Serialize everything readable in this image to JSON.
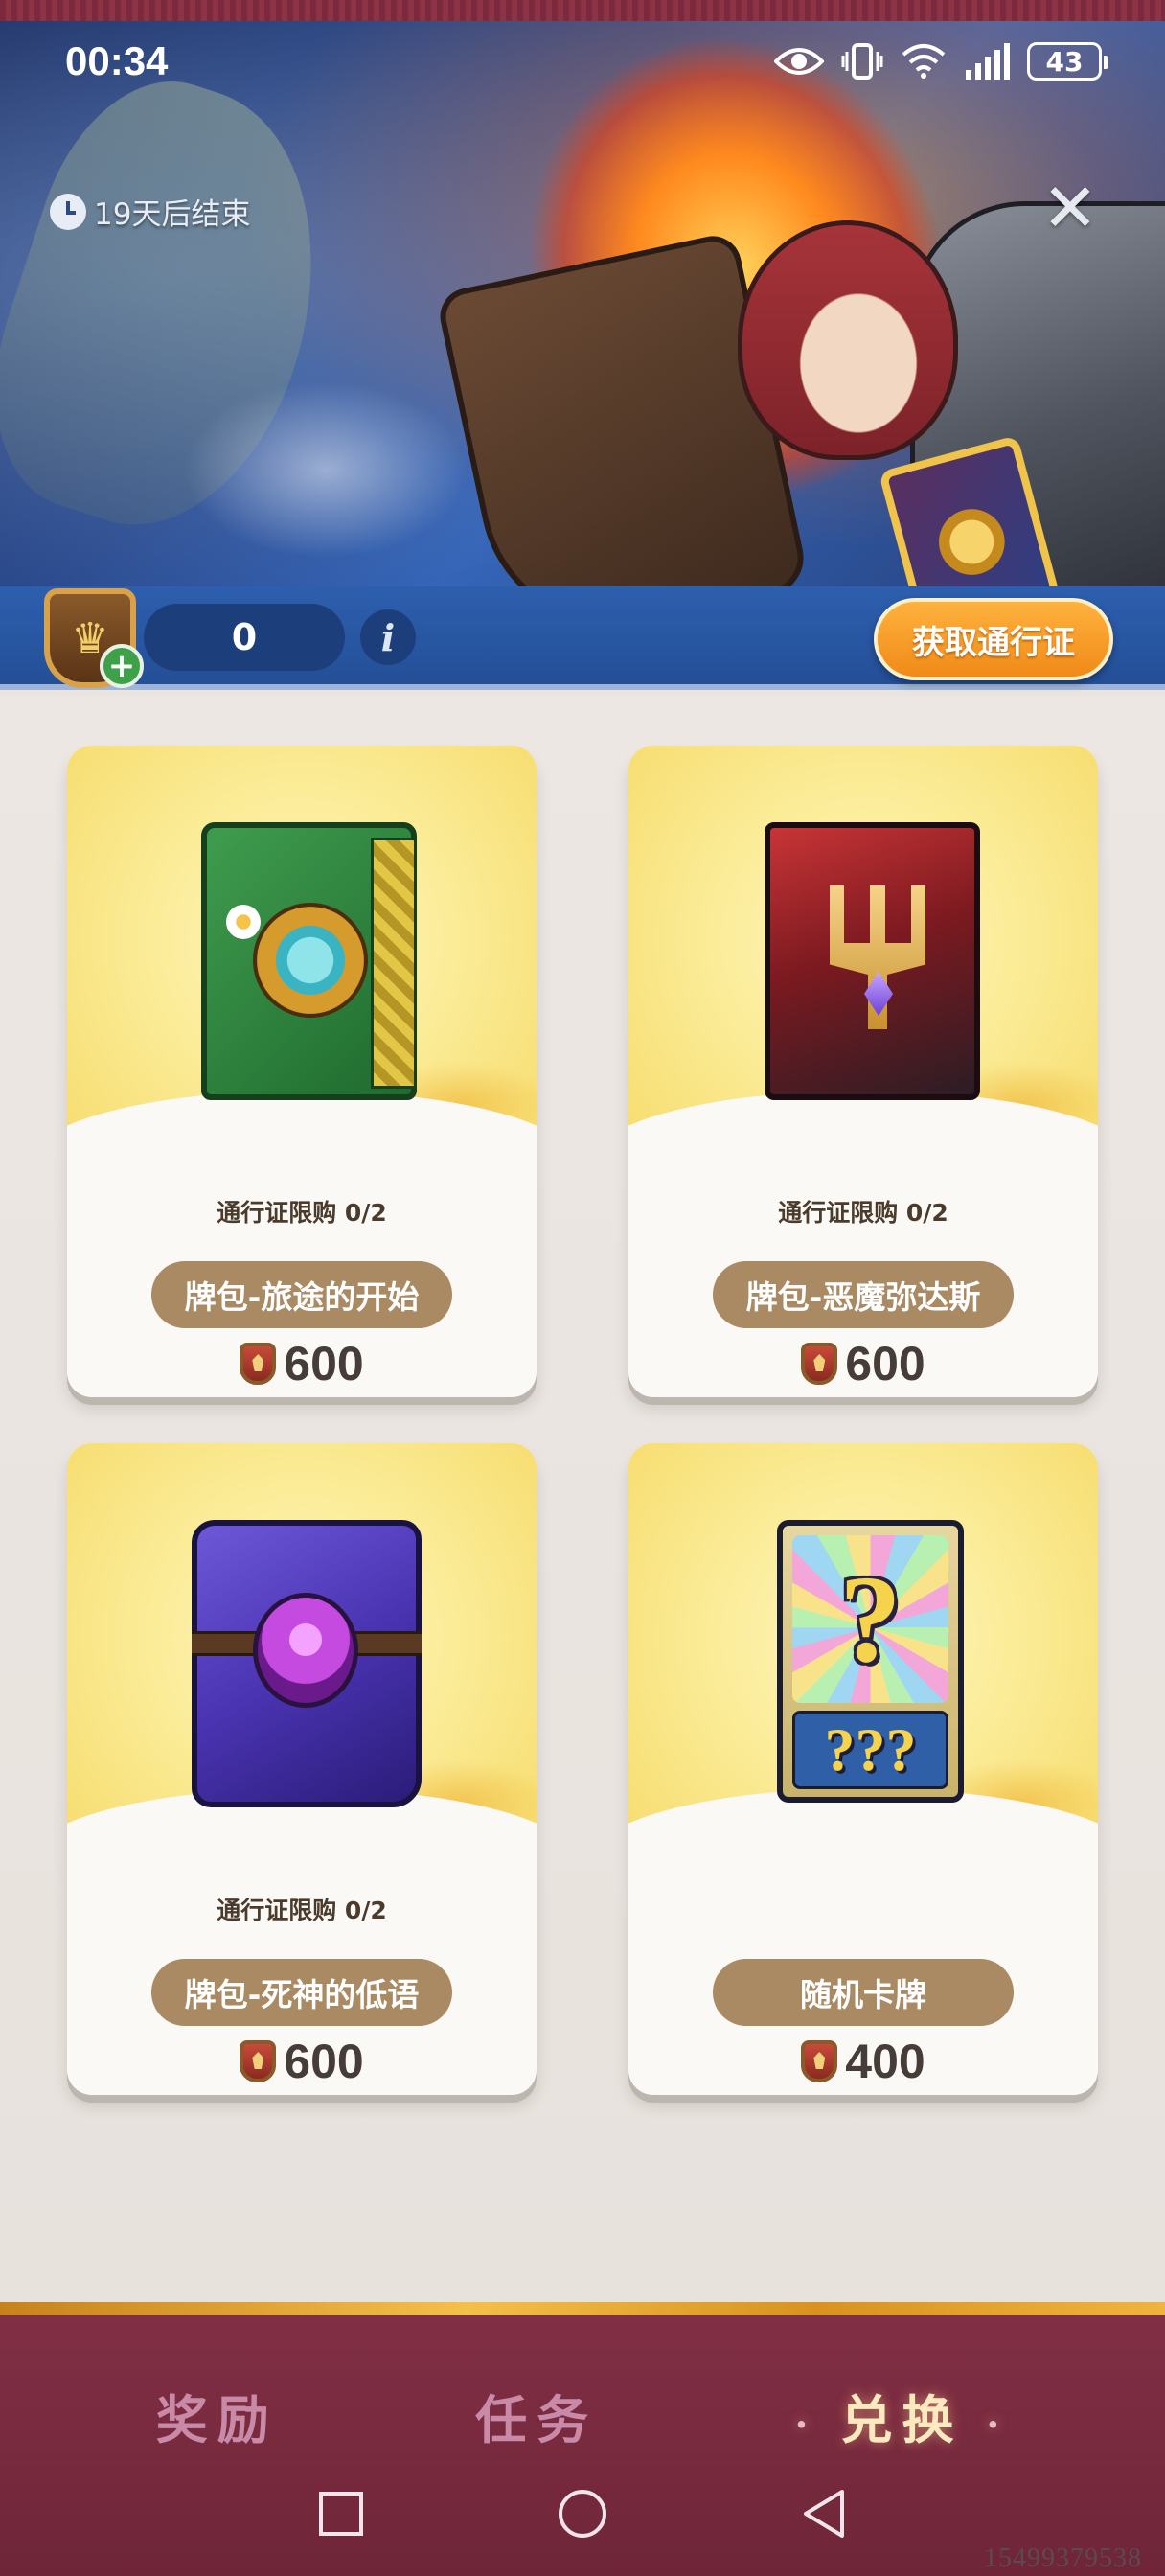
{
  "status_bar": {
    "time": "00:34",
    "battery": "43",
    "icons": [
      "eye-icon",
      "vibrate-icon",
      "wifi-icon",
      "signal-icon",
      "battery-icon"
    ]
  },
  "banner": {
    "timer_text": "19天后结束",
    "close_label": "✕",
    "points": "0",
    "info_label": "i",
    "get_pass_label": "获取通行证"
  },
  "cards": [
    {
      "limit": "通行证限购 0/2",
      "name": "牌包-旅途的开始",
      "price": "600",
      "art": "green-card-pack-icon"
    },
    {
      "limit": "通行证限购 0/2",
      "name": "牌包-恶魔弥达斯",
      "price": "600",
      "art": "red-card-pack-icon"
    },
    {
      "limit": "通行证限购 0/2",
      "name": "牌包-死神的低语",
      "price": "600",
      "art": "purple-card-pack-icon"
    },
    {
      "limit": "",
      "name": "随机卡牌",
      "price": "400",
      "art": "random-card-icon"
    }
  ],
  "random_card": {
    "big_mark": "?",
    "small_mark": "???"
  },
  "tabs": [
    {
      "label": "奖励",
      "active": false
    },
    {
      "label": "任务",
      "active": false
    },
    {
      "label": "兑换",
      "active": true
    }
  ],
  "watermark": "15499379538",
  "colors": {
    "banner_blue": "#2d5fae",
    "accent_orange": "#f08a18",
    "nav_maroon": "#812f45",
    "pill_tan": "#a98a63"
  }
}
